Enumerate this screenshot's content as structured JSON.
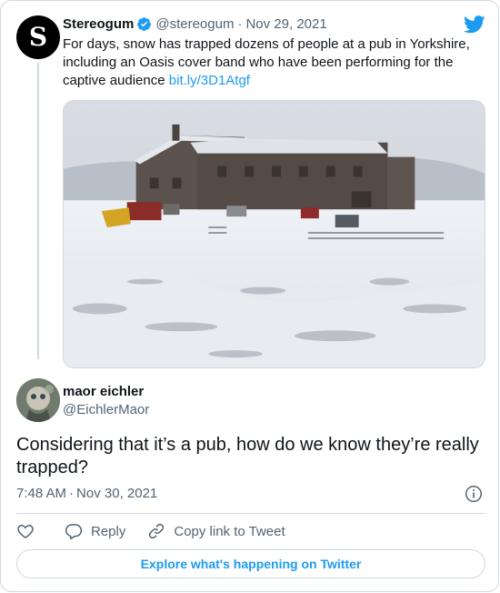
{
  "parent_tweet": {
    "avatar_letter": "S",
    "name": "Stereogum",
    "verified": true,
    "handle": "@stereogum",
    "separator": "·",
    "date": "Nov 29, 2021",
    "text": "For days, snow has trapped dozens of people at a pub in Yorkshire, including an Oasis cover band who have been performing for the captive audience",
    "link": "bit.ly/3D1Atgf",
    "media_icon": "snowy-pub-photo"
  },
  "tweet": {
    "author_name": "maor eichler",
    "author_handle": "@EichlerMaor",
    "text": "Considering that it’s a pub, how do we know they’re really trapped?",
    "time": "7:48 AM",
    "separator": "·",
    "date": "Nov 30, 2021"
  },
  "actions": {
    "like_icon": "heart-icon",
    "reply_label": "Reply",
    "copy_link_label": "Copy link to Tweet"
  },
  "footer": {
    "explore_label": "Explore what's happening on Twitter"
  },
  "colors": {
    "accent": "#1d9bf0",
    "text": "#0f1419",
    "secondary": "#536471",
    "border": "#cfd9de"
  }
}
